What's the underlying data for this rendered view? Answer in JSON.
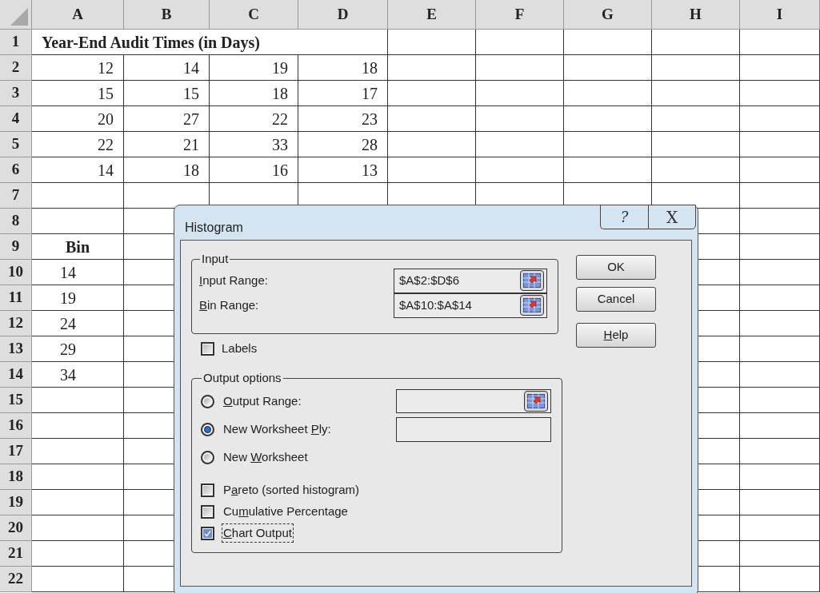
{
  "sheet": {
    "columns": [
      "A",
      "B",
      "C",
      "D",
      "E",
      "F",
      "G",
      "H",
      "I"
    ],
    "rows": [
      {
        "number": "1",
        "kind": "title",
        "cells": [
          "Year-End Audit Times (in Days)"
        ]
      },
      {
        "number": "2",
        "kind": "data",
        "cells": [
          "12",
          "14",
          "19",
          "18"
        ]
      },
      {
        "number": "3",
        "kind": "data",
        "cells": [
          "15",
          "15",
          "18",
          "17"
        ]
      },
      {
        "number": "4",
        "kind": "data",
        "cells": [
          "20",
          "27",
          "22",
          "23"
        ]
      },
      {
        "number": "5",
        "kind": "data",
        "cells": [
          "22",
          "21",
          "33",
          "28"
        ]
      },
      {
        "number": "6",
        "kind": "data",
        "cells": [
          "14",
          "18",
          "16",
          "13"
        ]
      },
      {
        "number": "7",
        "kind": "data"
      },
      {
        "number": "8",
        "kind": "data"
      },
      {
        "number": "9",
        "kind": "bin_header",
        "cells": [
          "Bin"
        ]
      },
      {
        "number": "10",
        "kind": "bin",
        "cells": [
          "14"
        ]
      },
      {
        "number": "11",
        "kind": "bin",
        "cells": [
          "19"
        ]
      },
      {
        "number": "12",
        "kind": "bin",
        "cells": [
          "24"
        ]
      },
      {
        "number": "13",
        "kind": "bin",
        "cells": [
          "29"
        ]
      },
      {
        "number": "14",
        "kind": "bin",
        "cells": [
          "34"
        ]
      },
      {
        "number": "15",
        "kind": "data"
      },
      {
        "number": "16",
        "kind": "data"
      },
      {
        "number": "17",
        "kind": "data"
      },
      {
        "number": "18",
        "kind": "data"
      },
      {
        "number": "19",
        "kind": "data"
      },
      {
        "number": "20",
        "kind": "data"
      },
      {
        "number": "21",
        "kind": "data"
      },
      {
        "number": "22",
        "kind": "data"
      }
    ]
  },
  "dialog": {
    "title": "Histogram",
    "title_buttons": [
      {
        "kind": "help",
        "text": "?"
      },
      {
        "kind": "close",
        "text": "X"
      }
    ],
    "input_group": {
      "label": "Input",
      "fields": [
        {
          "label": {
            "key": "I",
            "post": "nput Range:"
          },
          "value": "$A$2:$D$6"
        },
        {
          "label": {
            "key": "B",
            "post": "in Range:"
          },
          "value": "$A$10:$A$14"
        }
      ]
    },
    "labels_checkbox": {
      "label": {
        "pre": "Labels"
      },
      "checked": false
    },
    "buttons": [
      {
        "pre": "OK"
      },
      {
        "pre": "Cancel"
      },
      {
        "key": "H",
        "post": "elp"
      }
    ],
    "output_group": {
      "label": "Output options",
      "options": [
        {
          "kind": "radio",
          "label": {
            "key": "O",
            "post": "utput Range:"
          },
          "selected": false,
          "field": {
            "kind": "picker"
          }
        },
        {
          "kind": "radio",
          "label": {
            "pre": "New Worksheet ",
            "key": "P",
            "post": "ly:"
          },
          "selected": true,
          "field": {
            "kind": "plain"
          }
        },
        {
          "kind": "radio",
          "label": {
            "pre": "New ",
            "key": "W",
            "post": "orksheet"
          },
          "selected": false
        },
        {
          "kind": "checkbox",
          "label": {
            "pre": "P",
            "key": "a",
            "post": "reto (sorted histogram)"
          },
          "checked": false,
          "focused": false
        },
        {
          "kind": "checkbox",
          "label": {
            "pre": "Cu",
            "key": "m",
            "post": "ulative Percentage"
          },
          "checked": false,
          "focused": false
        },
        {
          "kind": "checkbox",
          "label": {
            "key": "C",
            "post": "hart Output"
          },
          "checked": true,
          "focused": true
        }
      ]
    }
  }
}
